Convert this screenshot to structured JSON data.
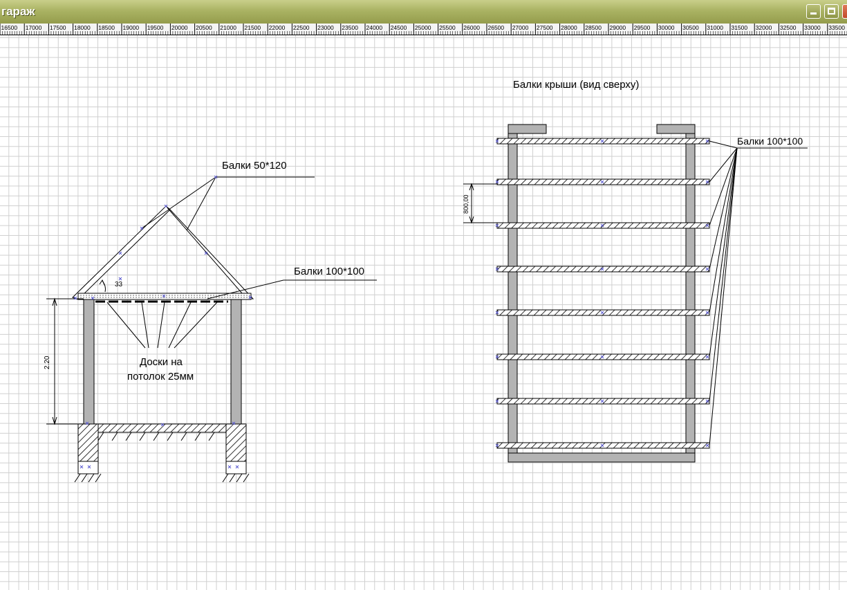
{
  "window": {
    "title": "гараж"
  },
  "ruler": {
    "labels": [
      "16500",
      "17000",
      "17500",
      "18000",
      "18500",
      "19000",
      "19500",
      "20000",
      "20500",
      "21000",
      "21500",
      "22000",
      "22500",
      "23000",
      "23500",
      "24000",
      "24500",
      "25000",
      "25500",
      "26000",
      "26500",
      "27000",
      "27500",
      "28000",
      "28500",
      "29000",
      "29500",
      "30000",
      "30500",
      "31000",
      "31500",
      "32000",
      "32500",
      "33000",
      "33500"
    ]
  },
  "drawing": {
    "label_beams_50x120": "Балки 50*120",
    "label_beams_100x100_section": "Балки 100*100",
    "label_angle": "33",
    "label_boards_line1": "Доски на",
    "label_boards_line2": "потолок 25мм",
    "label_height": "2.20",
    "plan_title": "Балки крыши (вид сверху)",
    "label_beams_100x100_plan": "Балки 100*100",
    "label_spacing": "800,00"
  }
}
